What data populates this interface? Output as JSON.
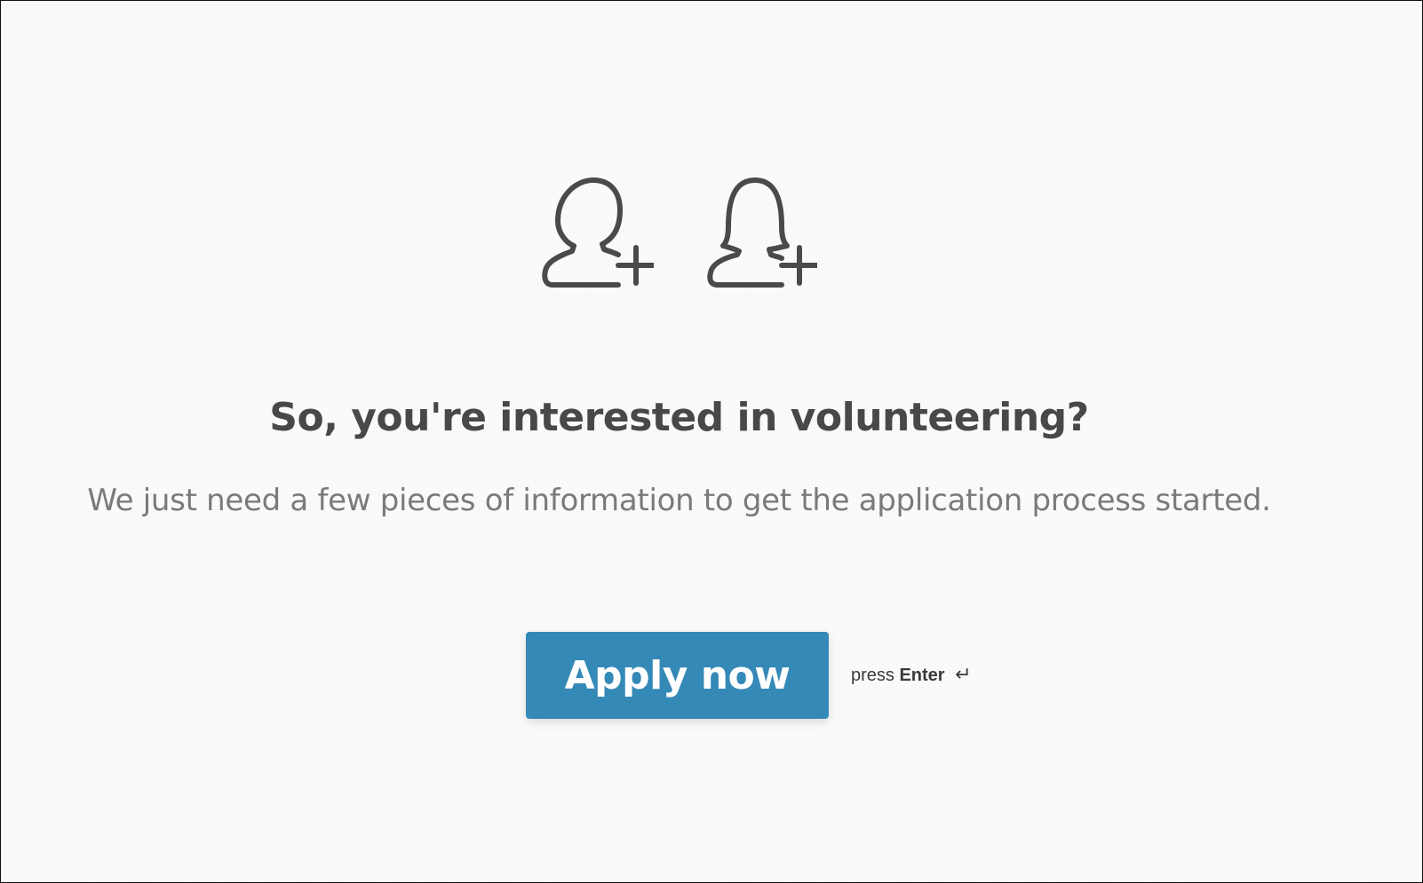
{
  "icons": {
    "male": "user-plus-icon",
    "female": "user-female-plus-icon",
    "color": "#4a4a4a"
  },
  "title": "So, you're interested in volunteering?",
  "subtitle": "We just need a few pieces of information to get the application process started.",
  "button": {
    "label": "Apply now",
    "color": "#3589b7"
  },
  "hint": {
    "prefix": "press",
    "key": "Enter",
    "symbol": "↵"
  }
}
